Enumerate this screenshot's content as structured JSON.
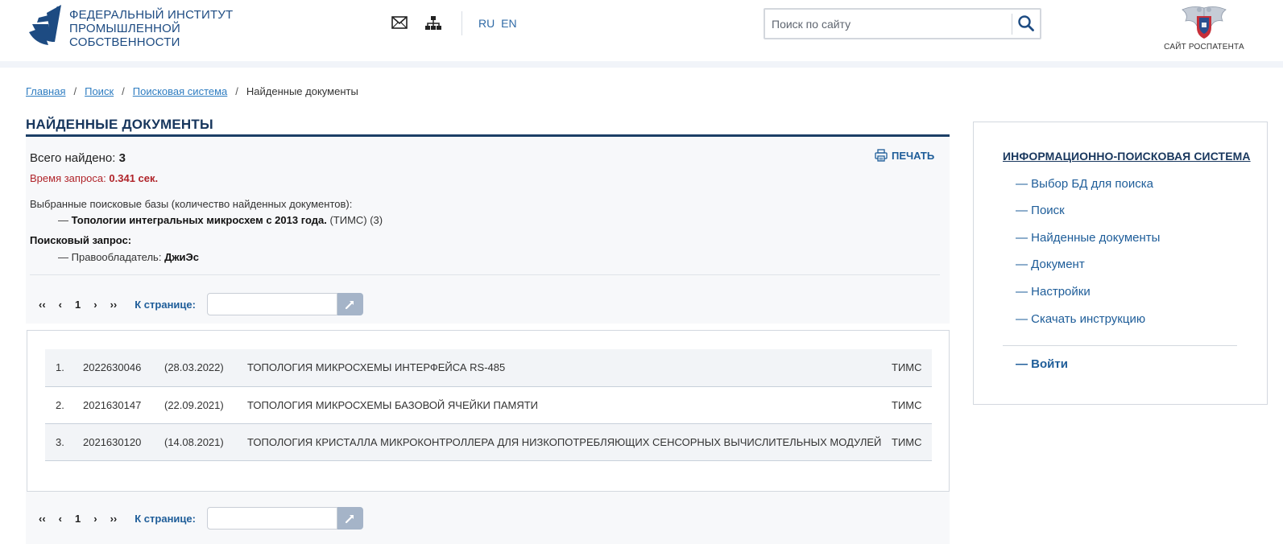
{
  "header": {
    "org_name_lines": [
      "Федеральный институт",
      "промышленной",
      "собственности"
    ],
    "languages": [
      "RU",
      "EN"
    ],
    "search_placeholder": "Поиск по сайту",
    "rospatent_label": "САЙТ РОСПАТЕНТА"
  },
  "breadcrumb": {
    "items": [
      "Главная",
      "Поиск",
      "Поисковая система"
    ],
    "current": "Найденные документы",
    "separator": "/"
  },
  "main": {
    "title": "Найденные документы",
    "found_label": "Всего найдено:",
    "found_count": "3",
    "time_label": "Время запроса:",
    "time_value": "0.341 сек.",
    "print_label": "ПЕЧАТЬ",
    "db_label": "Выбранные поисковые базы (количество найденных документов):",
    "db_dash": "—",
    "db_name": "Топологии интегральных микросхем с 2013 года.",
    "db_suffix": "(ТИМС) (3)",
    "query_label": "Поисковый запрос:",
    "query_dash": "—",
    "query_field": "Правообладатель:",
    "query_value": "ДжиЭс"
  },
  "pager": {
    "first": "‹‹",
    "prev": "‹",
    "current": "1",
    "next": "›",
    "last": "››",
    "goto_label": "К странице:"
  },
  "results": [
    {
      "num": "1.",
      "id": "2022630046",
      "date": "(28.03.2022)",
      "title": "ТОПОЛОГИЯ МИКРОСХЕМЫ ИНТЕРФЕЙСА RS-485",
      "db": "ТИМС"
    },
    {
      "num": "2.",
      "id": "2021630147",
      "date": "(22.09.2021)",
      "title": "ТОПОЛОГИЯ МИКРОСХЕМЫ БАЗОВОЙ ЯЧЕЙКИ ПАМЯТИ",
      "db": "ТИМС"
    },
    {
      "num": "3.",
      "id": "2021630120",
      "date": "(14.08.2021)",
      "title": "ТОПОЛОГИЯ КРИСТАЛЛА МИКРОКОНТРОЛЛЕРА ДЛЯ НИЗКОПОТРЕБЛЯЮЩИХ СЕНСОРНЫХ ВЫЧИСЛИТЕЛЬНЫХ МОДУЛЕЙ",
      "db": "ТИМС"
    }
  ],
  "sidebar": {
    "title": "Информационно-поисковая система",
    "items": [
      "— Выбор БД для поиска",
      "— Поиск",
      "— Найденные документы",
      "— Документ",
      "— Настройки",
      "— Скачать инструкцию"
    ],
    "login": "— Войти"
  },
  "colors": {
    "brand": "#1d4b82",
    "link": "#2f7dc1",
    "accent_red": "#b0242a",
    "title_line": "#1c3f66"
  },
  "icons": [
    "fips-logo",
    "mail-icon",
    "sitemap-icon",
    "search-icon",
    "rospatent-emblem",
    "printer-icon",
    "arrow-go-icon"
  ]
}
